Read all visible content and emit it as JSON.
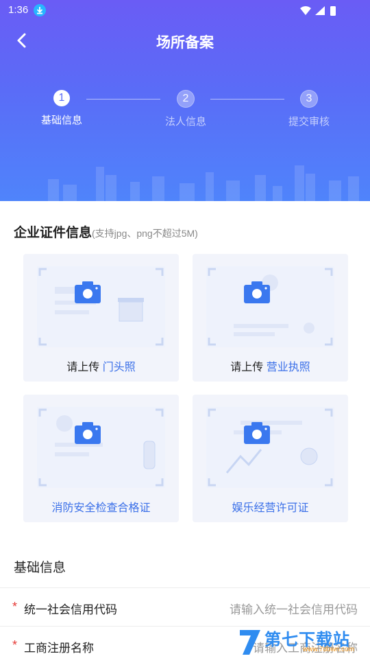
{
  "status": {
    "time": "1:36"
  },
  "header": {
    "title": "场所备案"
  },
  "steps": [
    {
      "num": "1",
      "label": "基础信息"
    },
    {
      "num": "2",
      "label": "法人信息"
    },
    {
      "num": "3",
      "label": "提交审核"
    }
  ],
  "certs": {
    "title": "企业证件信息",
    "hint": "(支持jpg、png不超过5M)",
    "cards": [
      {
        "prefix": "请上传",
        "highlight": "门头照"
      },
      {
        "prefix": "请上传",
        "highlight": "营业执照"
      },
      {
        "prefix": "",
        "highlight": "消防安全检查合格证"
      },
      {
        "prefix": "",
        "highlight": "娱乐经营许可证"
      }
    ]
  },
  "basic": {
    "title": "基础信息",
    "fields": [
      {
        "required": "*",
        "label": "统一社会信用代码",
        "placeholder": "请输入统一社会信用代码"
      },
      {
        "required": "*",
        "label": "工商注册名称",
        "placeholder": "请输入工商注册名称"
      }
    ]
  },
  "watermark": {
    "text": "第七下载站",
    "url": "www.7down.com"
  },
  "colors": {
    "accent": "#3a6fe8",
    "header_start": "#6a5cf5",
    "header_end": "#4f84fb",
    "required": "#e53935"
  }
}
